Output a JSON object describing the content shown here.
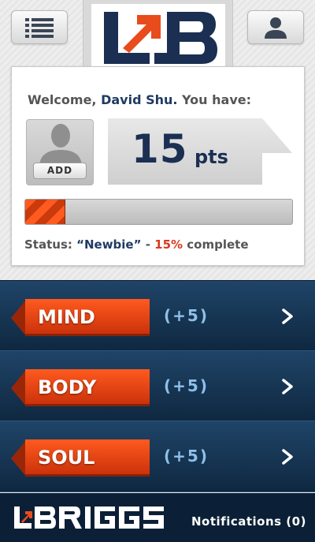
{
  "header": {
    "menu_icon": "list-icon",
    "profile_icon": "user-icon",
    "logo_icon": "lb-logo",
    "logo_colors": {
      "navy": "#1b2f52",
      "orange": "#e84c1c"
    }
  },
  "welcome": {
    "prefix": "Welcome,",
    "name": "David Shu.",
    "suffix": " You have:"
  },
  "avatar": {
    "icon": "person-silhouette-icon",
    "add_label": "ADD"
  },
  "points": {
    "value": "15",
    "unit": "pts"
  },
  "progress": {
    "percent": 15,
    "fill_color": "#ff5a1f"
  },
  "status": {
    "label": "Status:",
    "level": "“Newbie”",
    "separator": " - ",
    "percent_text": "15%",
    "suffix": " complete"
  },
  "categories": [
    {
      "label": "MIND",
      "bonus": "(+5)",
      "icon": "chevron-right-icon"
    },
    {
      "label": "BODY",
      "bonus": "(+5)",
      "icon": "chevron-right-icon"
    },
    {
      "label": "SOUL",
      "bonus": "(+5)",
      "icon": "chevron-right-icon"
    }
  ],
  "footer": {
    "brand": "LBRIGGS",
    "notifications_label": "Notifications (0)"
  },
  "colors": {
    "accent": "#e84c1c",
    "navy": "#1b2f52",
    "row_bg": "#1a3c5e",
    "bonus": "#8fc0ea"
  }
}
